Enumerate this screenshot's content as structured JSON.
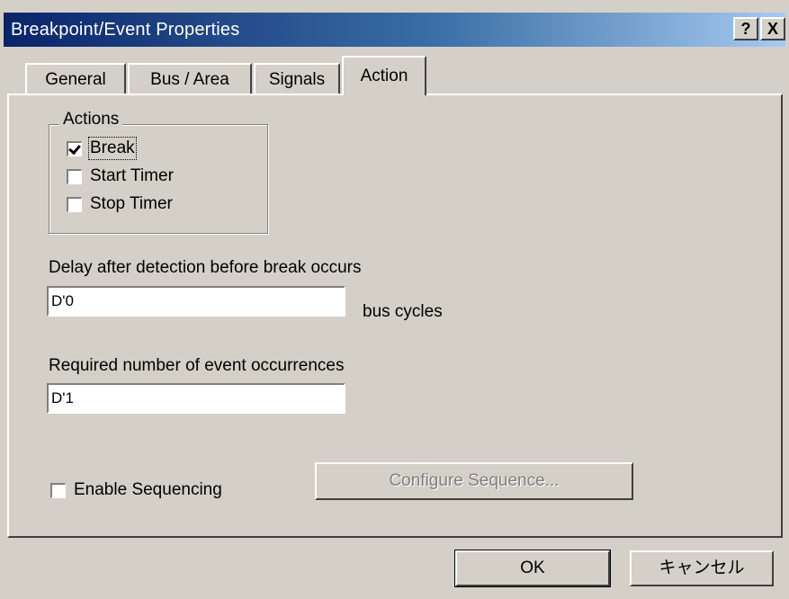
{
  "window": {
    "title": "Breakpoint/Event Properties",
    "help_glyph": "?",
    "close_glyph": "X"
  },
  "tabs": [
    {
      "label": "General",
      "active": false
    },
    {
      "label": "Bus / Area",
      "active": false
    },
    {
      "label": "Signals",
      "active": false
    },
    {
      "label": "Action",
      "active": true
    }
  ],
  "actions_group": {
    "label": "Actions",
    "items": [
      {
        "label": "Break",
        "checked": true
      },
      {
        "label": "Start Timer",
        "checked": false
      },
      {
        "label": "Stop Timer",
        "checked": false
      }
    ]
  },
  "delay": {
    "label": "Delay after detection before break occurs",
    "value": "D'0",
    "unit": "bus cycles"
  },
  "occurrences": {
    "label": "Required number of event occurrences",
    "value": "D'1"
  },
  "sequencing": {
    "label": "Enable Sequencing",
    "checked": false,
    "configure_label": "Configure Sequence..."
  },
  "buttons": {
    "ok": "OK",
    "cancel": "キャンセル"
  }
}
